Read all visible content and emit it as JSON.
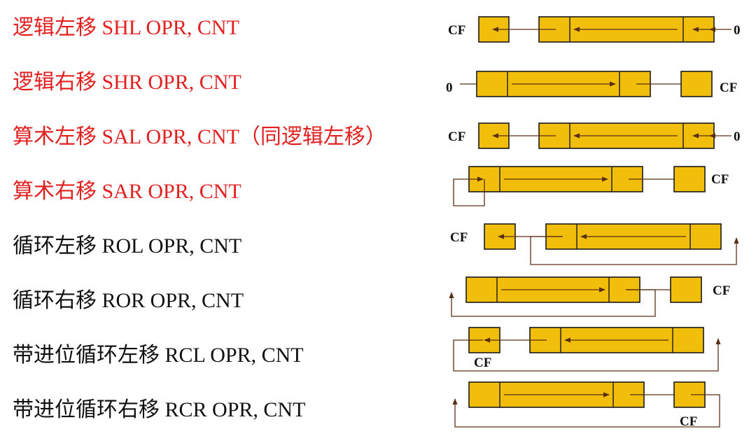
{
  "colors": {
    "box_fill": "#f2be0c",
    "box_stroke": "#1a1a1a",
    "arrow": "#5a2e14",
    "label_red": "#e32020",
    "label_black": "#111111"
  },
  "flag_text": "CF",
  "zero_text": "0",
  "rows": [
    {
      "label": "逻辑左移  SHL  OPR, CNT",
      "color": "red",
      "kind": "left",
      "carry": "outer",
      "input_zero": true
    },
    {
      "label": "逻辑右移  SHR  OPR, CNT",
      "color": "red",
      "kind": "right",
      "carry": "outer",
      "input_zero": true
    },
    {
      "label": "算术左移  SAL  OPR, CNT（同逻辑左移）",
      "color": "red",
      "kind": "left",
      "carry": "outer",
      "input_zero": true
    },
    {
      "label": "算术右移  SAR  OPR, CNT",
      "color": "red",
      "kind": "right",
      "carry": "outer",
      "input_zero": false,
      "msb_loop": true
    },
    {
      "label": "循环左移  ROL  OPR, CNT",
      "color": "black",
      "kind": "left",
      "carry": "outer",
      "loop": "rot"
    },
    {
      "label": "循环右移  ROR  OPR, CNT",
      "color": "black",
      "kind": "right",
      "carry": "outer",
      "loop": "rot"
    },
    {
      "label": "带进位循环左移  RCL  OPR, CNT",
      "color": "black",
      "kind": "left",
      "carry": "below",
      "loop": "rc"
    },
    {
      "label": "带进位循环右移  RCR  OPR, CNT",
      "color": "black",
      "kind": "right",
      "carry": "below",
      "loop": "rc"
    }
  ]
}
